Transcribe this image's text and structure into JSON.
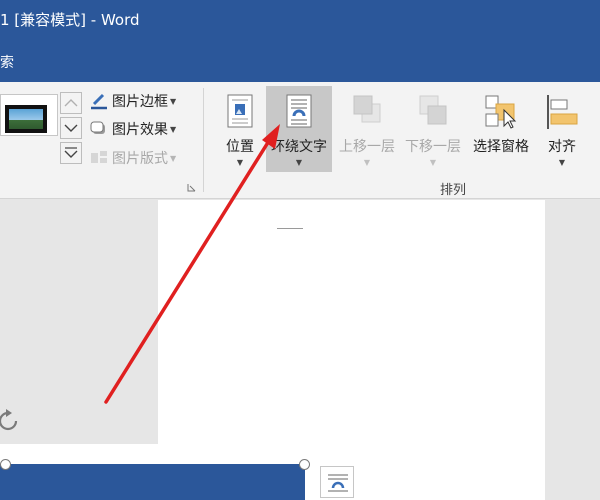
{
  "window": {
    "title": "1 [兼容模式] - Word"
  },
  "menu": {
    "visible_fragment": "索"
  },
  "ribbon": {
    "picture_styles": {
      "border_label": "图片边框",
      "effects_label": "图片效果",
      "layout_label": "图片版式"
    },
    "arrange": {
      "position_label": "位置",
      "wrap_text_label": "环绕文字",
      "bring_forward_label": "上移一层",
      "send_backward_label": "下移一层",
      "selection_pane_label": "选择窗格",
      "align_label": "对齐",
      "group_label": "排列"
    }
  },
  "colors": {
    "word_blue": "#2b579a",
    "annotation_arrow": "#e02020"
  }
}
